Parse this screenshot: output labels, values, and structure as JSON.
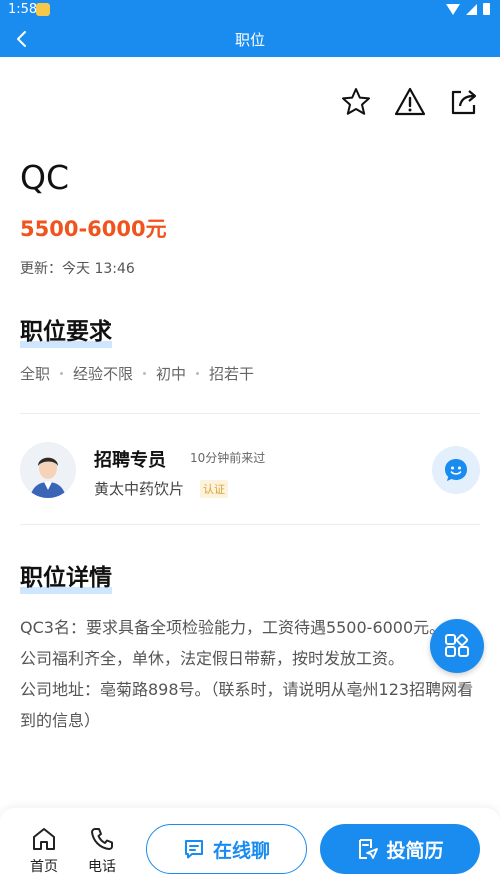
{
  "status_bar": {
    "time": "1:58"
  },
  "app_bar": {
    "title": "职位"
  },
  "job": {
    "title": "QC",
    "salary": "5500-6000元",
    "updated": "更新：今天 13:46"
  },
  "requirements": {
    "heading": "职位要求",
    "tags": [
      "全职",
      "经验不限",
      "初中",
      "招若干"
    ]
  },
  "recruiter": {
    "name": "招聘专员",
    "last_seen": "10分钟前来过",
    "company": "黄太中药饮片",
    "verified_label": "认证"
  },
  "details": {
    "heading": "职位详情",
    "lines": [
      "QC3名：要求具备全项检验能力，工资待遇5500-6000元。",
      "公司福利齐全，单休，法定假日带薪，按时发放工资。",
      "公司地址：亳菊路898号。（联系时，请说明从亳州123招聘网看到的信息）"
    ]
  },
  "bottom_bar": {
    "home_label": "首页",
    "phone_label": "电话",
    "chat_label": "在线聊",
    "apply_label": "投简历"
  },
  "colors": {
    "primary": "#1a8cf0",
    "salary": "#f0531c",
    "verified": "#d9a23a"
  }
}
